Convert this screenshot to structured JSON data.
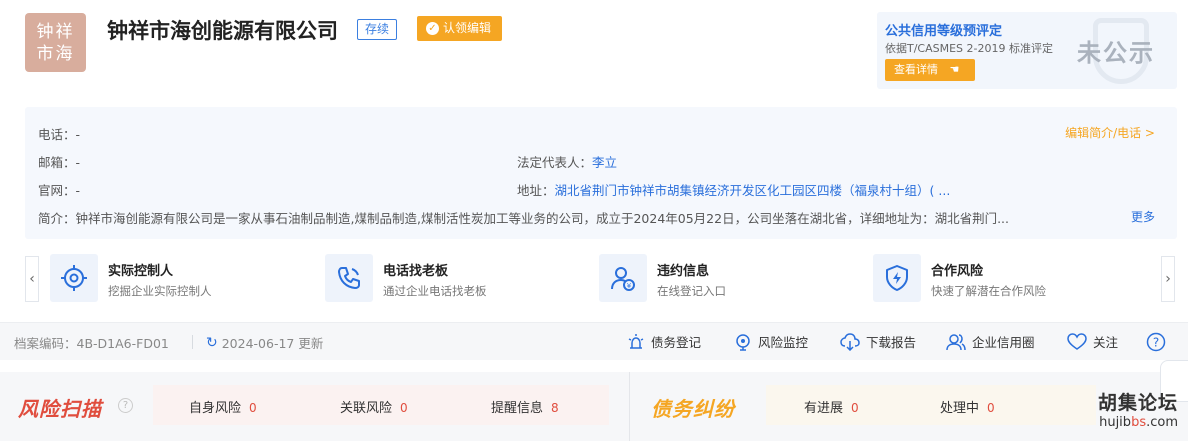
{
  "company": {
    "logo_line1": "钟祥",
    "logo_line2": "市海",
    "name": "钟祥市海创能源有限公司",
    "status": "存续",
    "claim_label": "认领编辑"
  },
  "credit": {
    "title": "公共信用等级预评定",
    "subtitle": "依据T/CASMES 2-2019 标准评定",
    "detail_label": "查看详情",
    "grade": "未公示"
  },
  "info": {
    "phone_label": "电话：",
    "phone": "-",
    "email_label": "邮箱：",
    "email": "-",
    "website_label": "官网：",
    "website": "-",
    "legal_rep_label": "法定代表人：",
    "legal_rep": "李立",
    "address_label": "地址：",
    "address": "湖北省荆门市钟祥市胡集镇经济开发区化工园区四楼（福泉村十组）( ...",
    "brief_label": "简介：",
    "brief": "钟祥市海创能源有限公司是一家从事石油制品制造,煤制品制造,煤制活性炭加工等业务的公司，成立于2024年05月22日，公司坐落在湖北省，详细地址为：湖北省荆门...",
    "edit_link": "编辑简介/电话 >",
    "more_link": "更多"
  },
  "cards": [
    {
      "title": "实际控制人",
      "desc": "挖掘企业实际控制人",
      "icon": "target-icon"
    },
    {
      "title": "电话找老板",
      "desc": "通过企业电话找老板",
      "icon": "phone-icon"
    },
    {
      "title": "违约信息",
      "desc": "在线登记入口",
      "icon": "user-yen-icon"
    },
    {
      "title": "合作风险",
      "desc": "快速了解潜在合作风险",
      "icon": "shield-bolt-icon"
    }
  ],
  "toolbar": {
    "archive": "档案编码：4B-D1A6-FD01",
    "updated": "2024-06-17 更新",
    "tools": [
      "债务登记",
      "风险监控",
      "下载报告",
      "企业信用圈",
      "关注"
    ]
  },
  "risk": {
    "title": "风险扫描",
    "items": [
      {
        "label": "自身风险",
        "count": "0"
      },
      {
        "label": "关联风险",
        "count": "0"
      },
      {
        "label": "提醒信息",
        "count": "8"
      }
    ]
  },
  "debt": {
    "title": "债务纠纷",
    "items": [
      {
        "label": "有进展",
        "count": "0"
      },
      {
        "label": "处理中",
        "count": "0"
      }
    ]
  },
  "watermark": {
    "name": "胡集论坛",
    "url_prefix": "hujib",
    "url_red": "bs",
    "url_suffix": ".com"
  },
  "colors": {
    "primary": "#2a6fdb",
    "accent": "#f5a623",
    "risk": "#e04d3e"
  }
}
